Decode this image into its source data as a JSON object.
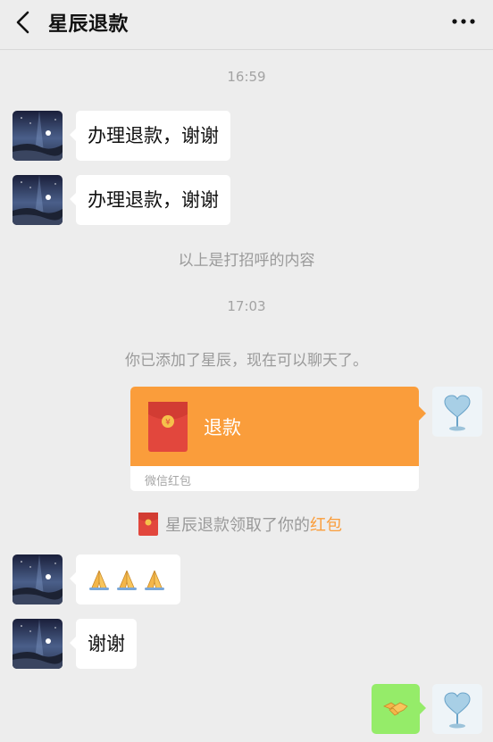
{
  "header": {
    "title": "星辰退款"
  },
  "messages": {
    "ts1": "16:59",
    "m1": "办理退款，谢谢",
    "m2": "办理退款，谢谢",
    "greeting_note": "以上是打招呼的内容",
    "ts2": "17:03",
    "added_note": "你已添加了星辰，现在可以聊天了。",
    "red_packet_title": "退款",
    "red_packet_label": "微信红包",
    "claim_prefix": "星辰退款领取了你的",
    "claim_link": "红包",
    "m6": "谢谢"
  },
  "icons": {
    "back": "chevron-left-icon",
    "more": "more-dots-icon",
    "red_packet": "red-packet-icon",
    "pray": "pray-hands-emoji",
    "handshake": "handshake-emoji"
  },
  "colors": {
    "background": "#ededed",
    "red_packet": "#fa9d3b",
    "my_bubble": "#95ec69",
    "link": "#fa9d3b"
  }
}
